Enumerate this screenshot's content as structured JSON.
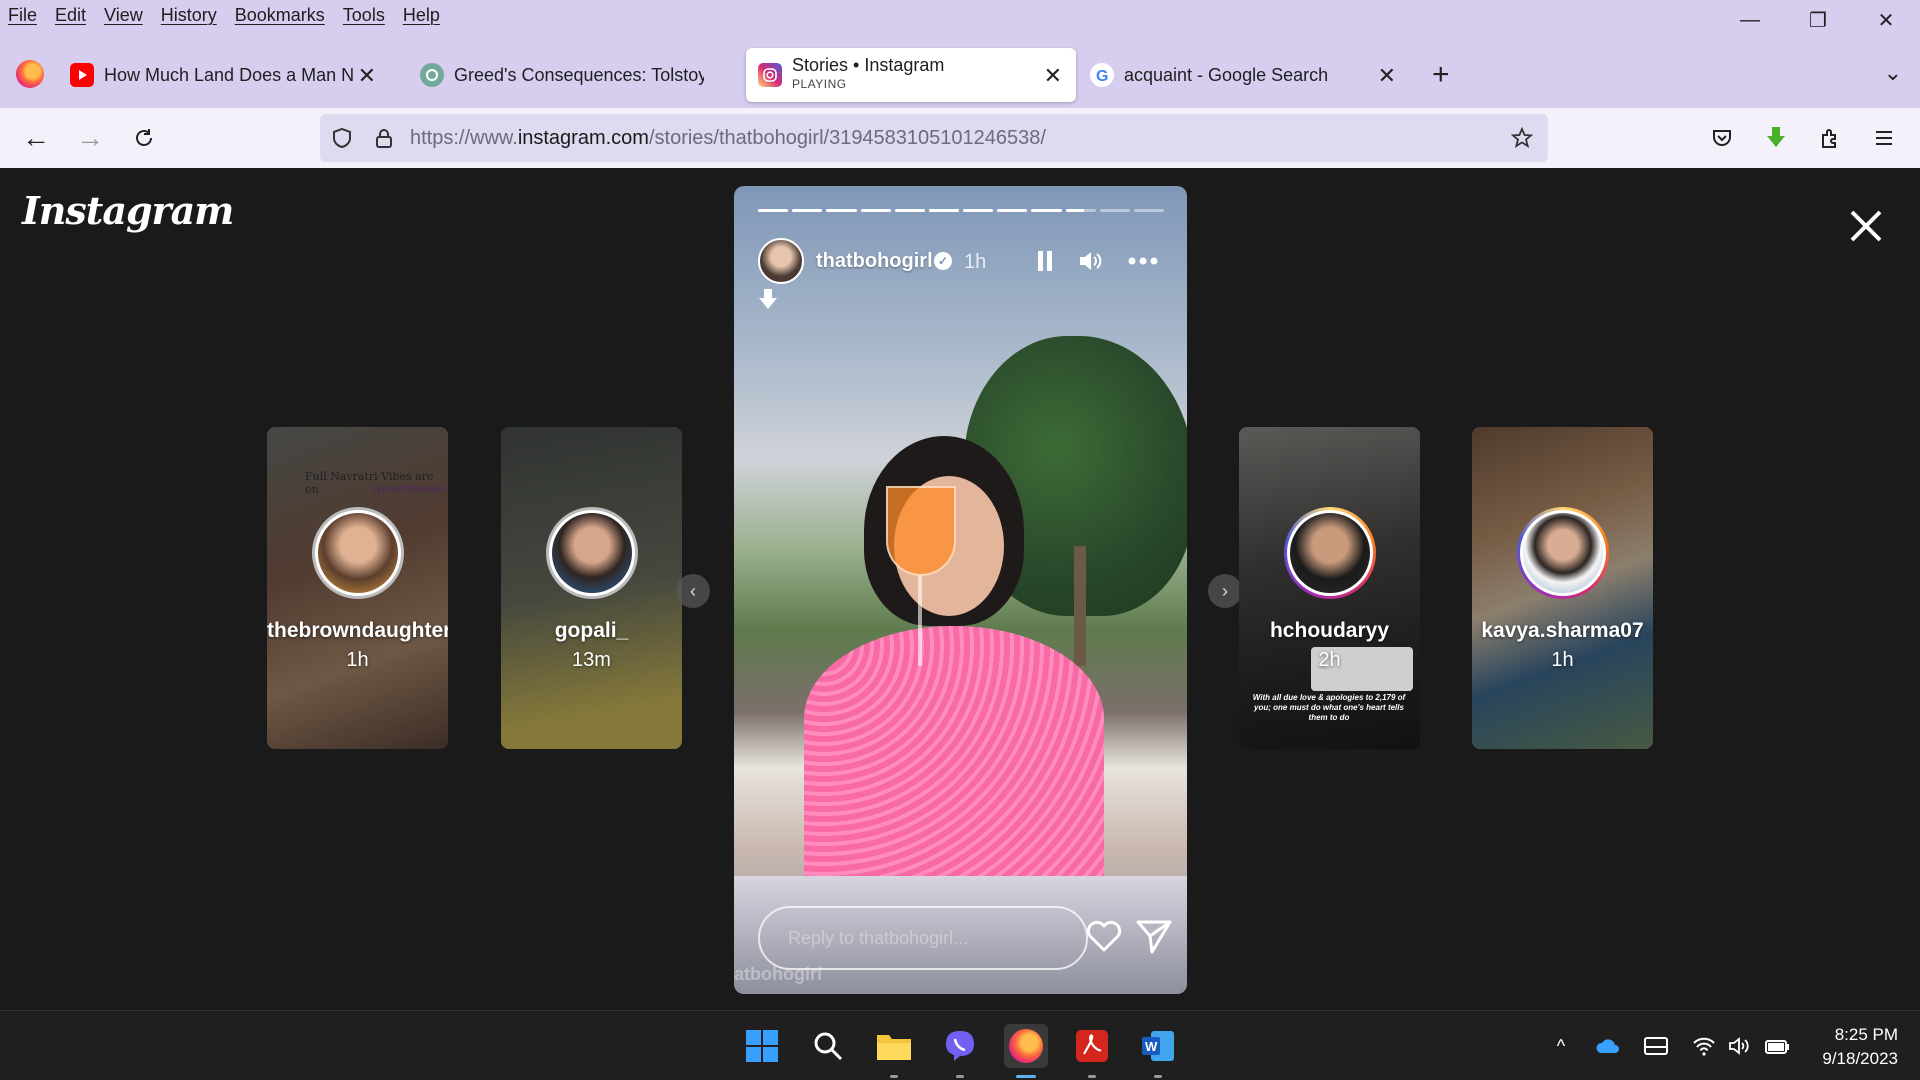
{
  "menu": [
    "File",
    "Edit",
    "View",
    "History",
    "Bookmarks",
    "Tools",
    "Help"
  ],
  "tabs": [
    {
      "title": "How Much Land Does a Man N",
      "favicon": "youtube-icon"
    },
    {
      "title": "Greed's Consequences: Tolstoy",
      "favicon": "chatgpt-icon"
    },
    {
      "title": "Stories • Instagram",
      "subtitle": "PLAYING",
      "favicon": "instagram-icon"
    },
    {
      "title": "acquaint - Google Search",
      "favicon": "google-icon"
    }
  ],
  "url": {
    "prefix": "https://www.",
    "domain": "instagram.com",
    "path": "/stories/thatbohogirl/3194583105101246538/"
  },
  "page": {
    "logo": "Instagram"
  },
  "story": {
    "username": "thatbohogirl",
    "time": "1h",
    "segments_total": 12,
    "segments_done": 9,
    "current_progress": 0.6,
    "reply_placeholder": "Reply to thatbohogirl...",
    "footer_user": "atbohogirl"
  },
  "side_stories": [
    {
      "username": "thebrowndaughter",
      "age": "1h",
      "overlay_text": "Full Navratri Vibes are on",
      "overlay_tag": "@prachithelabel"
    },
    {
      "username": "gopali_",
      "age": "13m"
    },
    {
      "username": "hchoudaryy",
      "age": "2h",
      "overlay_text": "With all due love & apologies to 2,179 of you; one must do what one's heart tells them to do"
    },
    {
      "username": "kavya.sharma07",
      "age": "1h"
    }
  ],
  "taskbar": {
    "time": "8:25 PM",
    "date": "9/18/2023"
  },
  "colors": {
    "chrome": "#d6cdef",
    "page_bg": "#1a1a1a",
    "accent": "#5fb2f2"
  }
}
